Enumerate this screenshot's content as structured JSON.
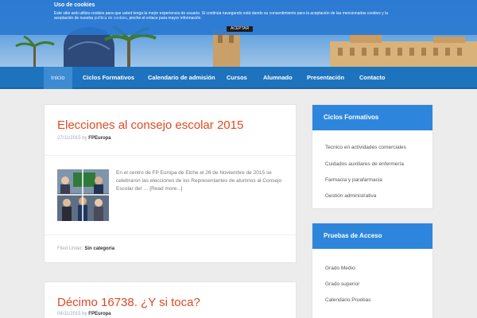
{
  "cookie": {
    "title": "Uso de cookies",
    "text": "Este sitio web utiliza cookies para que usted tenga la mejor experiencia de usuario. Si continúa navegando está dando su consentimiento para la aceptación de las mencionadas cookies y la aceptación de nuestra",
    "link": "política de cookies",
    "text_end": ", pinche el enlace para mayor información",
    "accept_label": "ACEPTAR"
  },
  "nav": {
    "items": [
      "Inicio",
      "Ciclos Formativos",
      "Calendario de admisión",
      "Cursos",
      "Alumnado",
      "Presentación",
      "Contacto"
    ]
  },
  "posts": [
    {
      "title": "Elecciones al consejo escolar 2015",
      "date": "27/11/2015",
      "by": "by",
      "author": "FPEuropa",
      "excerpt": "En el centro de FP Europa de Elche el 26 de Noviembre de 2015 se celebraron las elecciones de los Representantes de alumnos al Consejo Escolar del …",
      "read_more": "[Read more...]",
      "filed_label": "Filed Under:",
      "category": "Sin categoría"
    },
    {
      "title": "Décimo 16738. ¿Y si toca?",
      "date": "04/11/2015",
      "by": "by",
      "author": "FPEuropa"
    }
  ],
  "sidebar": {
    "widget1": {
      "title": "Ciclos Formativos",
      "items": [
        "Tecnico en actividades comerciales",
        "Cuidados auxiliares de enfermería",
        "Farmacia y parafarmacia",
        "Gestión administrativa"
      ]
    },
    "widget2": {
      "title": "Pruebas de Acceso",
      "items": [
        "Grado Medio",
        "Grado superior",
        "Calendario Pruebas"
      ]
    }
  },
  "colors": {
    "accent": "#1e73be",
    "title": "#e04a22",
    "widget_head": "#2e86dc"
  }
}
